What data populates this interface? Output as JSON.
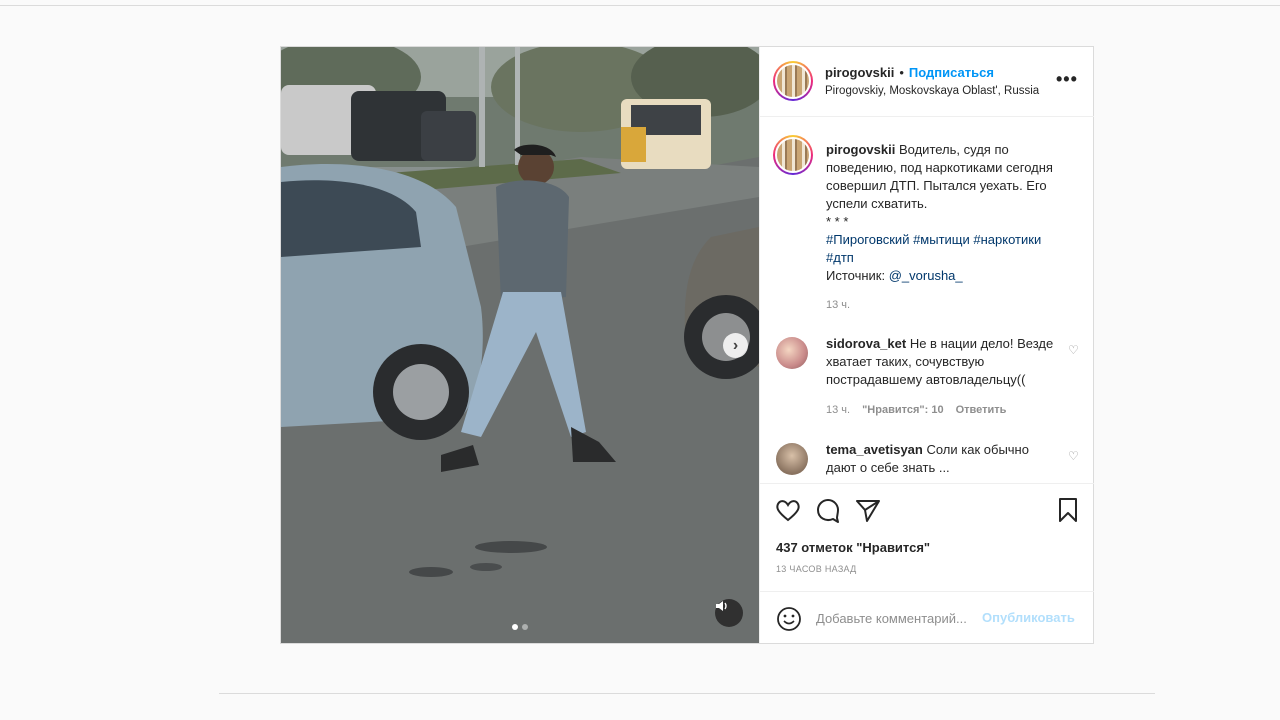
{
  "post": {
    "username": "pirogovskii",
    "separator": "•",
    "follow_label": "Подписаться",
    "location": "Pirogovskiy, Moskovskaya Oblast', Russia",
    "more_icon": "more-options-icon",
    "caption": {
      "username": "pirogovskii",
      "text_line": "Водитель, судя по поведению, под наркотиками сегодня совершил ДТП. Пытался уехать. Его успели схватить.",
      "stars": "* * *",
      "hashtags": [
        "#Пироговский",
        "#мытищи",
        "#наркотики",
        "#дтп"
      ],
      "source_label": "Источник:",
      "source_mention": "@_vorusha_",
      "time": "13 ч."
    },
    "comments": [
      {
        "username": "sidorova_ket",
        "text": "Не в нации дело! Везде хватает таких, сочувствую пострадавшему автовладельцу((",
        "time": "13 ч.",
        "likes": "\"Нравится\": 10",
        "reply_label": "Ответить"
      },
      {
        "username": "tema_avetisyan",
        "text": "Соли как обычно дают о себе знать ...",
        "time": "",
        "likes": "",
        "reply_label": ""
      }
    ],
    "likes_text": "437 отметок \"Нравится\"",
    "posted_ago": "13 ЧАСОВ НАЗАД",
    "comment_placeholder": "Добавьте комментарий...",
    "publish_label": "Опубликовать",
    "carousel": {
      "count": 2,
      "active": 0
    }
  },
  "colors": {
    "link": "#0095f6",
    "hashtag": "#00376b",
    "muted": "#8e8e8e",
    "border": "#dbdbdb"
  }
}
